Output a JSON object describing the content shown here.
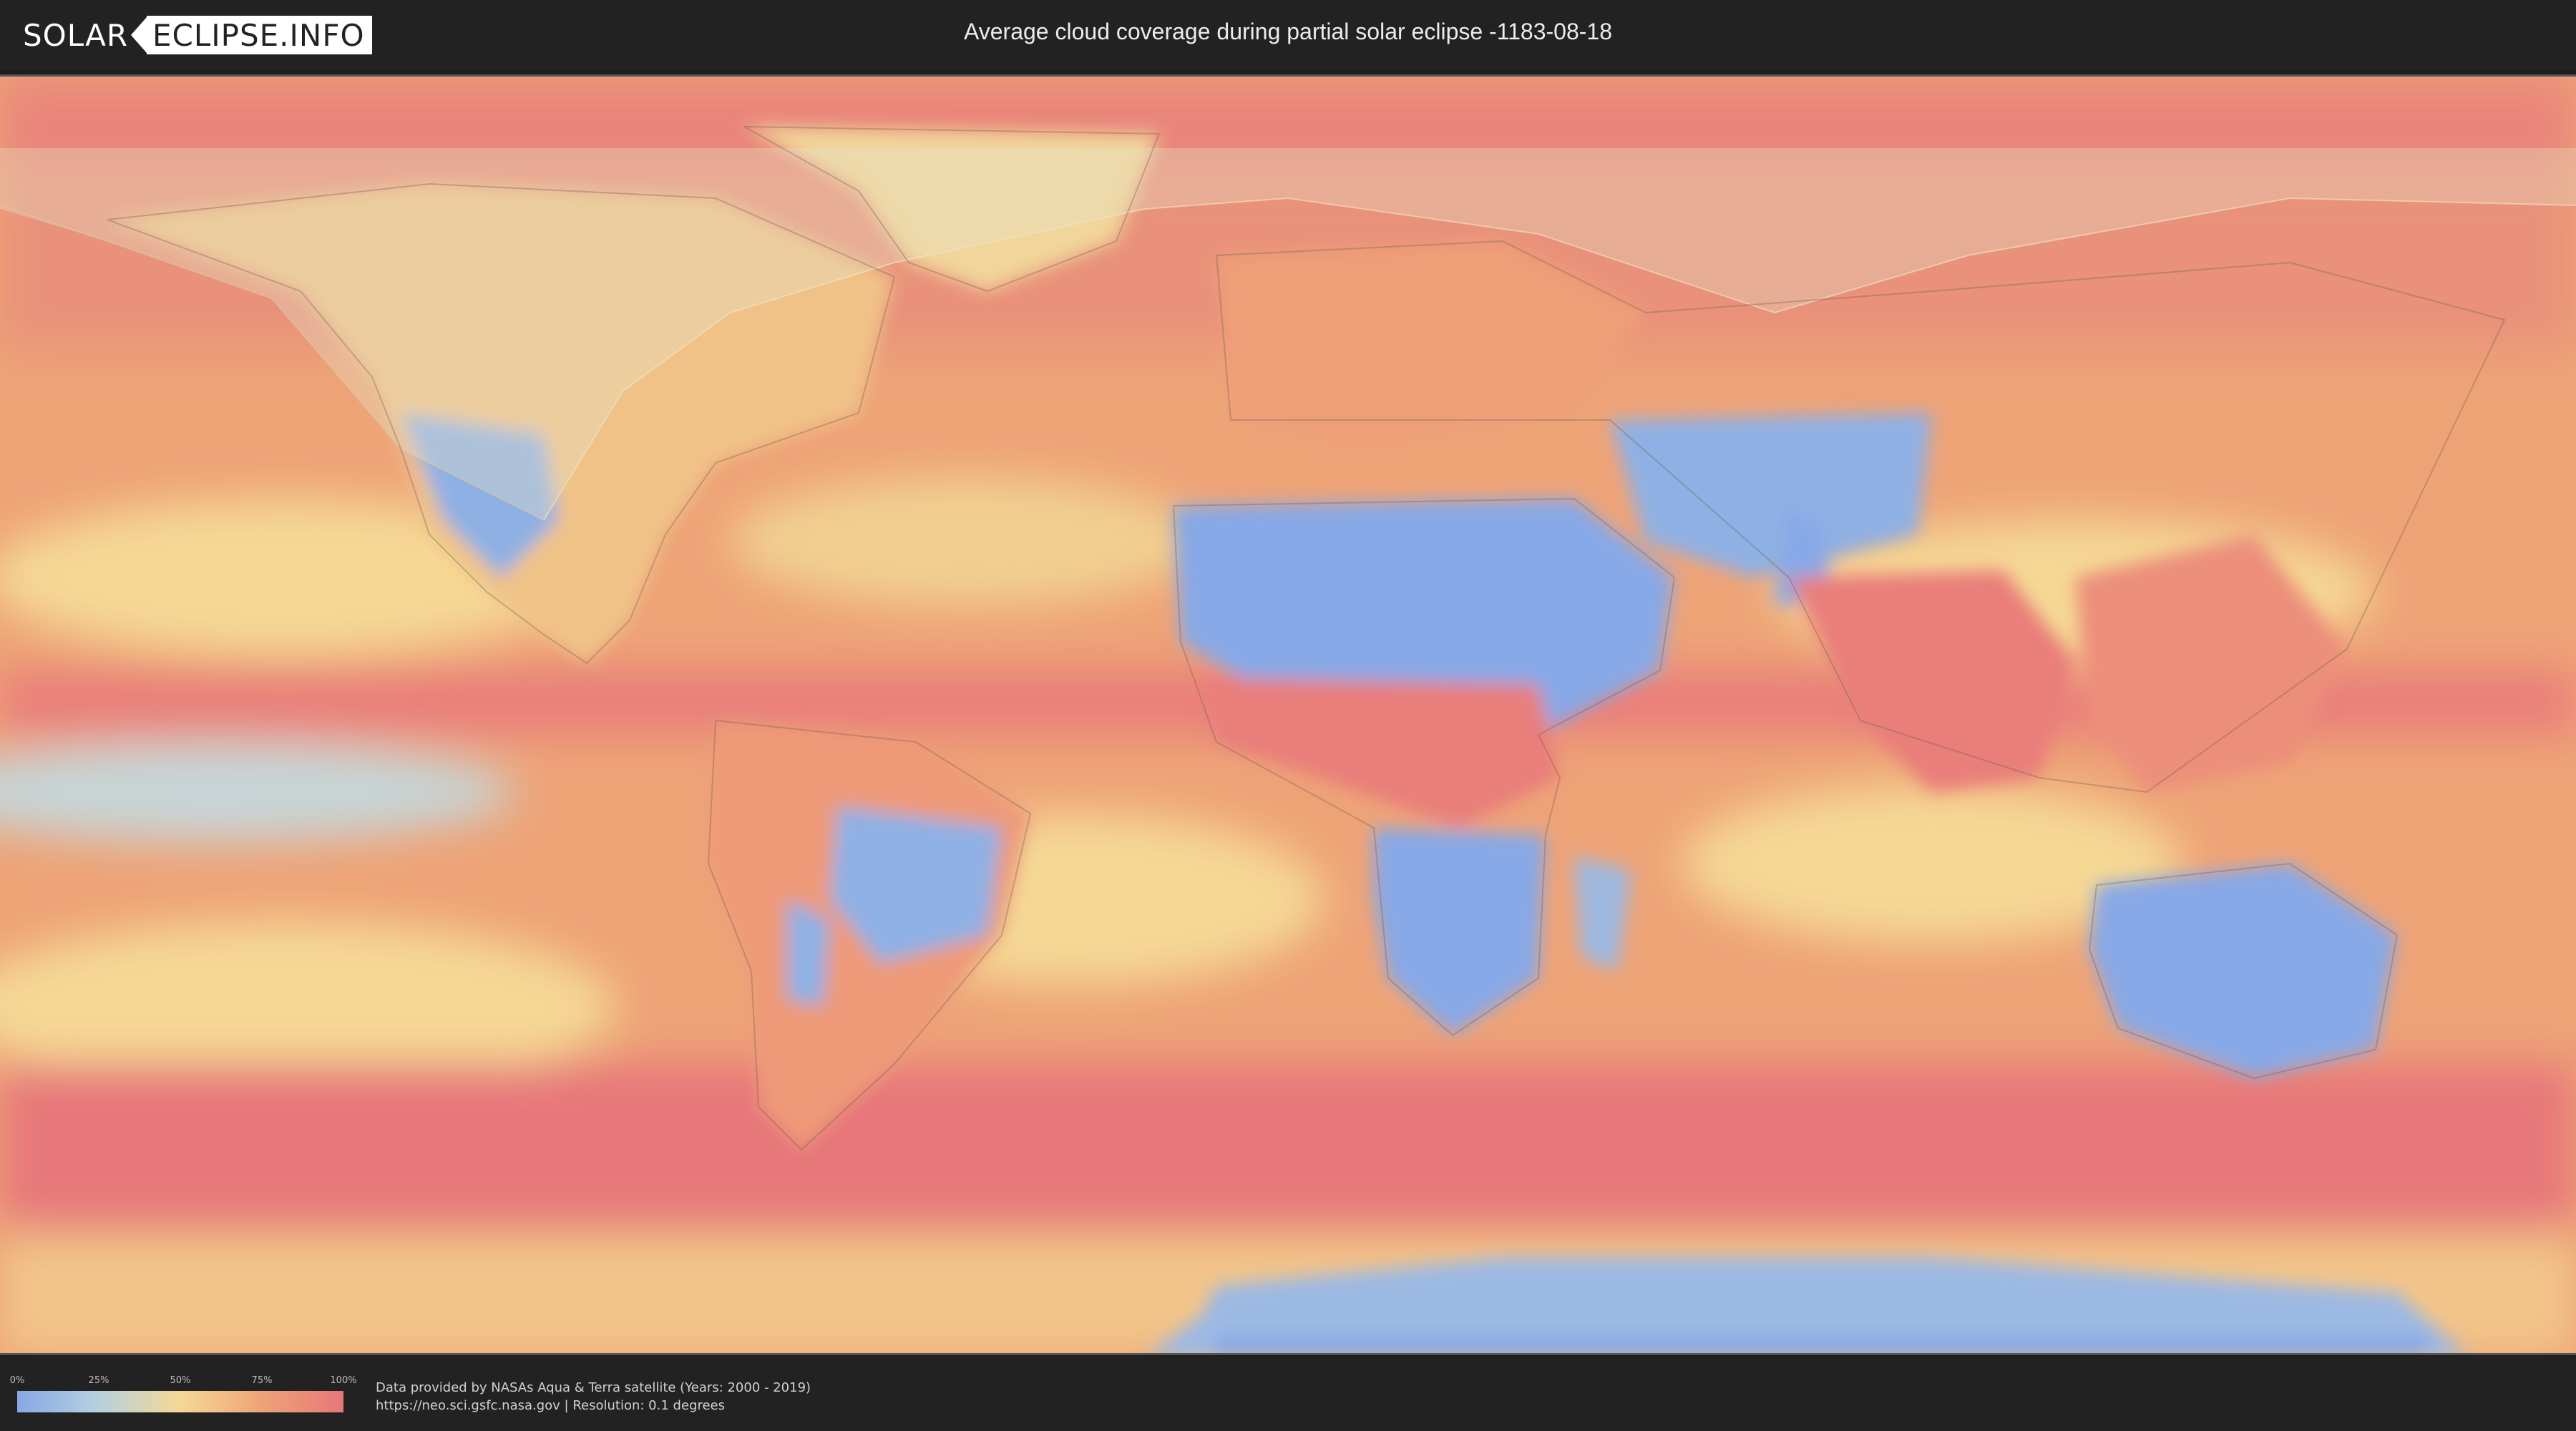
{
  "header": {
    "logo_left": "SOLAR",
    "logo_right": "ECLIPSE.INFO",
    "title": "Average cloud coverage during partial solar eclipse -1183-08-18"
  },
  "map": {
    "description_icon": "world-map-cloud-coverage",
    "palette": {
      "clear": "#87a8e6",
      "low": "#b7d0df",
      "mid": "#f5d894",
      "high": "#eea377",
      "overcast": "#e7777a",
      "eclipse_shadow": "#e6e2c6"
    }
  },
  "legend": {
    "ticks": [
      "0%",
      "25%",
      "50%",
      "75%",
      "100%"
    ],
    "gradient_colors": [
      "#87a8e6",
      "#b7d0df",
      "#f5d894",
      "#eea377",
      "#e7777a"
    ]
  },
  "footer": {
    "line1": "Data provided by NASAs Aqua & Terra satellite (Years: 2000 - 2019)",
    "line2": "https://neo.sci.gsfc.nasa.gov | Resolution: 0.1 degrees"
  }
}
